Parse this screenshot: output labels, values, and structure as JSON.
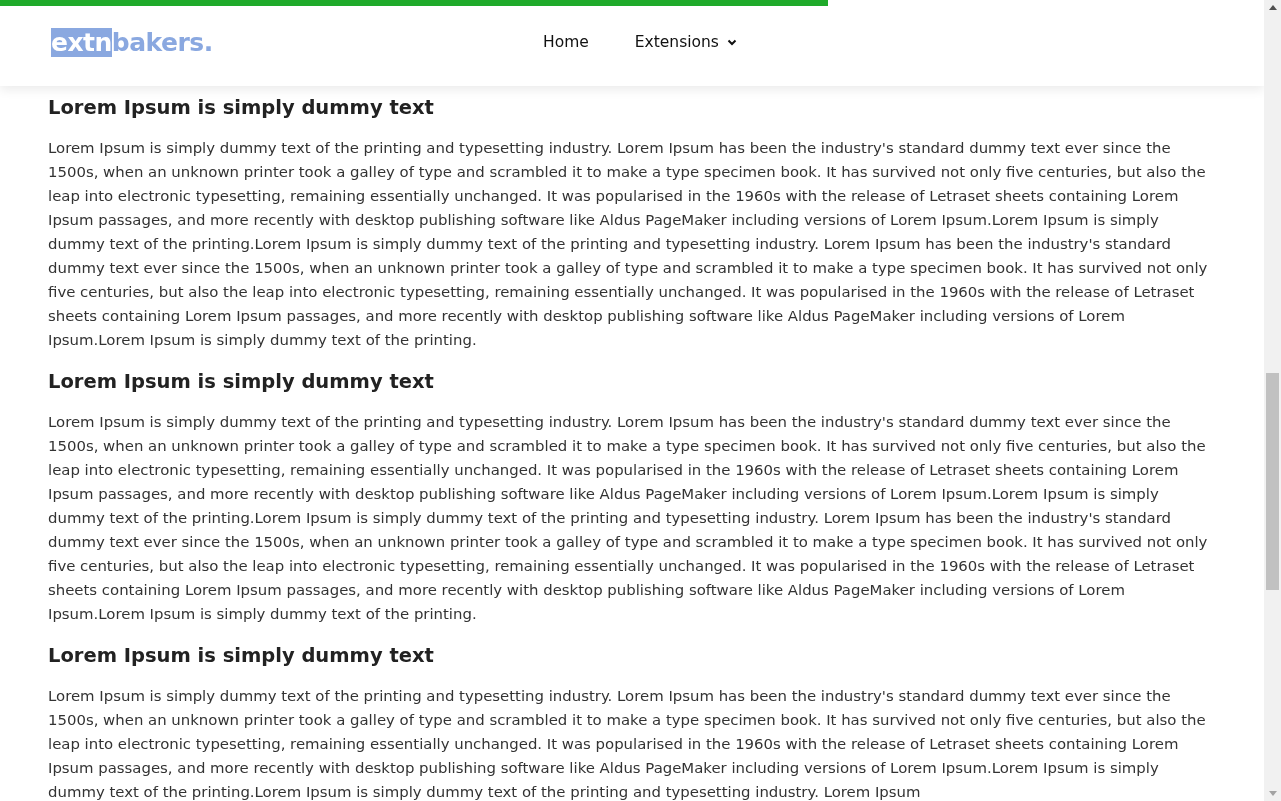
{
  "progress": {
    "level": 0.655
  },
  "header": {
    "logo": {
      "highlight": "extn",
      "text": "bakers."
    },
    "nav": [
      {
        "label": "Home",
        "kind": "link"
      },
      {
        "label": "Extensions",
        "kind": "dropdown"
      }
    ]
  },
  "sections": [
    {
      "heading": "Lorem Ipsum is simply dummy text",
      "body": "Lorem Ipsum is simply dummy text of the printing and typesetting industry. Lorem Ipsum has been the industry's standard dummy text ever since the 1500s, when an unknown printer took a galley of type and scrambled it to make a type specimen book. It has survived not only five centuries, but also the leap into electronic typesetting, remaining essentially unchanged. It was popularised in the 1960s with the release of Letraset sheets containing Lorem Ipsum passages, and more recently with desktop publishing software like Aldus PageMaker including versions of Lorem Ipsum.Lorem Ipsum is simply dummy text of the printing.Lorem Ipsum is simply dummy text of the printing and typesetting industry. Lorem Ipsum has been the industry's standard dummy text ever since the 1500s, when an unknown printer took a galley of type and scrambled it to make a type specimen book. It has survived not only five centuries, but also the leap into electronic typesetting, remaining essentially unchanged. It was popularised in the 1960s with the release of Letraset sheets containing Lorem Ipsum passages, and more recently with desktop publishing software like Aldus PageMaker including versions of Lorem Ipsum.Lorem Ipsum is simply dummy text of the printing."
    },
    {
      "heading": "Lorem Ipsum is simply dummy text",
      "body": "Lorem Ipsum is simply dummy text of the printing and typesetting industry. Lorem Ipsum has been the industry's standard dummy text ever since the 1500s, when an unknown printer took a galley of type and scrambled it to make a type specimen book. It has survived not only five centuries, but also the leap into electronic typesetting, remaining essentially unchanged. It was popularised in the 1960s with the release of Letraset sheets containing Lorem Ipsum passages, and more recently with desktop publishing software like Aldus PageMaker including versions of Lorem Ipsum.Lorem Ipsum is simply dummy text of the printing.Lorem Ipsum is simply dummy text of the printing and typesetting industry. Lorem Ipsum has been the industry's standard dummy text ever since the 1500s, when an unknown printer took a galley of type and scrambled it to make a type specimen book. It has survived not only five centuries, but also the leap into electronic typesetting, remaining essentially unchanged. It was popularised in the 1960s with the release of Letraset sheets containing Lorem Ipsum passages, and more recently with desktop publishing software like Aldus PageMaker including versions of Lorem Ipsum.Lorem Ipsum is simply dummy text of the printing."
    },
    {
      "heading": "Lorem Ipsum is simply dummy text",
      "body": "Lorem Ipsum is simply dummy text of the printing and typesetting industry. Lorem Ipsum has been the industry's standard dummy text ever since the 1500s, when an unknown printer took a galley of type and scrambled it to make a type specimen book. It has survived not only five centuries, but also the leap into electronic typesetting, remaining essentially unchanged. It was popularised in the 1960s with the release of Letraset sheets containing Lorem Ipsum passages, and more recently with desktop publishing software like Aldus PageMaker including versions of Lorem Ipsum.Lorem Ipsum is simply dummy text of the printing.Lorem Ipsum is simply dummy text of the printing and typesetting industry. Lorem Ipsum"
    }
  ]
}
